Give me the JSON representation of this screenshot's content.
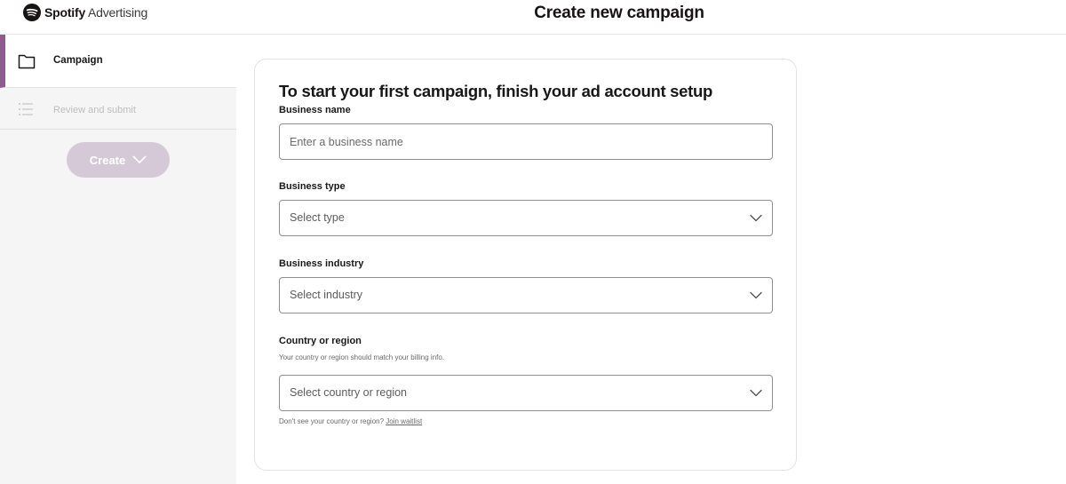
{
  "header": {
    "brand_bold": "Spotify",
    "brand_light": "Advertising",
    "title": "Create new campaign"
  },
  "sidebar": {
    "items": [
      {
        "label": "Campaign",
        "icon": "folder-icon",
        "active": true
      },
      {
        "label": "Review and submit",
        "icon": "list-icon",
        "active": false
      }
    ],
    "create_button": "Create"
  },
  "form": {
    "heading": "To start your first campaign, finish your ad account setup",
    "business_name": {
      "label": "Business name",
      "placeholder": "Enter a business name",
      "value": ""
    },
    "business_type": {
      "label": "Business type",
      "value": "Select type"
    },
    "business_industry": {
      "label": "Business industry",
      "value": "Select industry"
    },
    "country": {
      "label": "Country or region",
      "help": "Your country or region should match your billing info.",
      "value": "Select country or region"
    },
    "waitlist_prefix": "Don't see your country or region?",
    "waitlist_link": "Join waitlist"
  },
  "colors": {
    "accent": "#8e5b91",
    "create_button_bg": "#d6c9d7",
    "sidebar_bg": "#f5f5f5"
  }
}
